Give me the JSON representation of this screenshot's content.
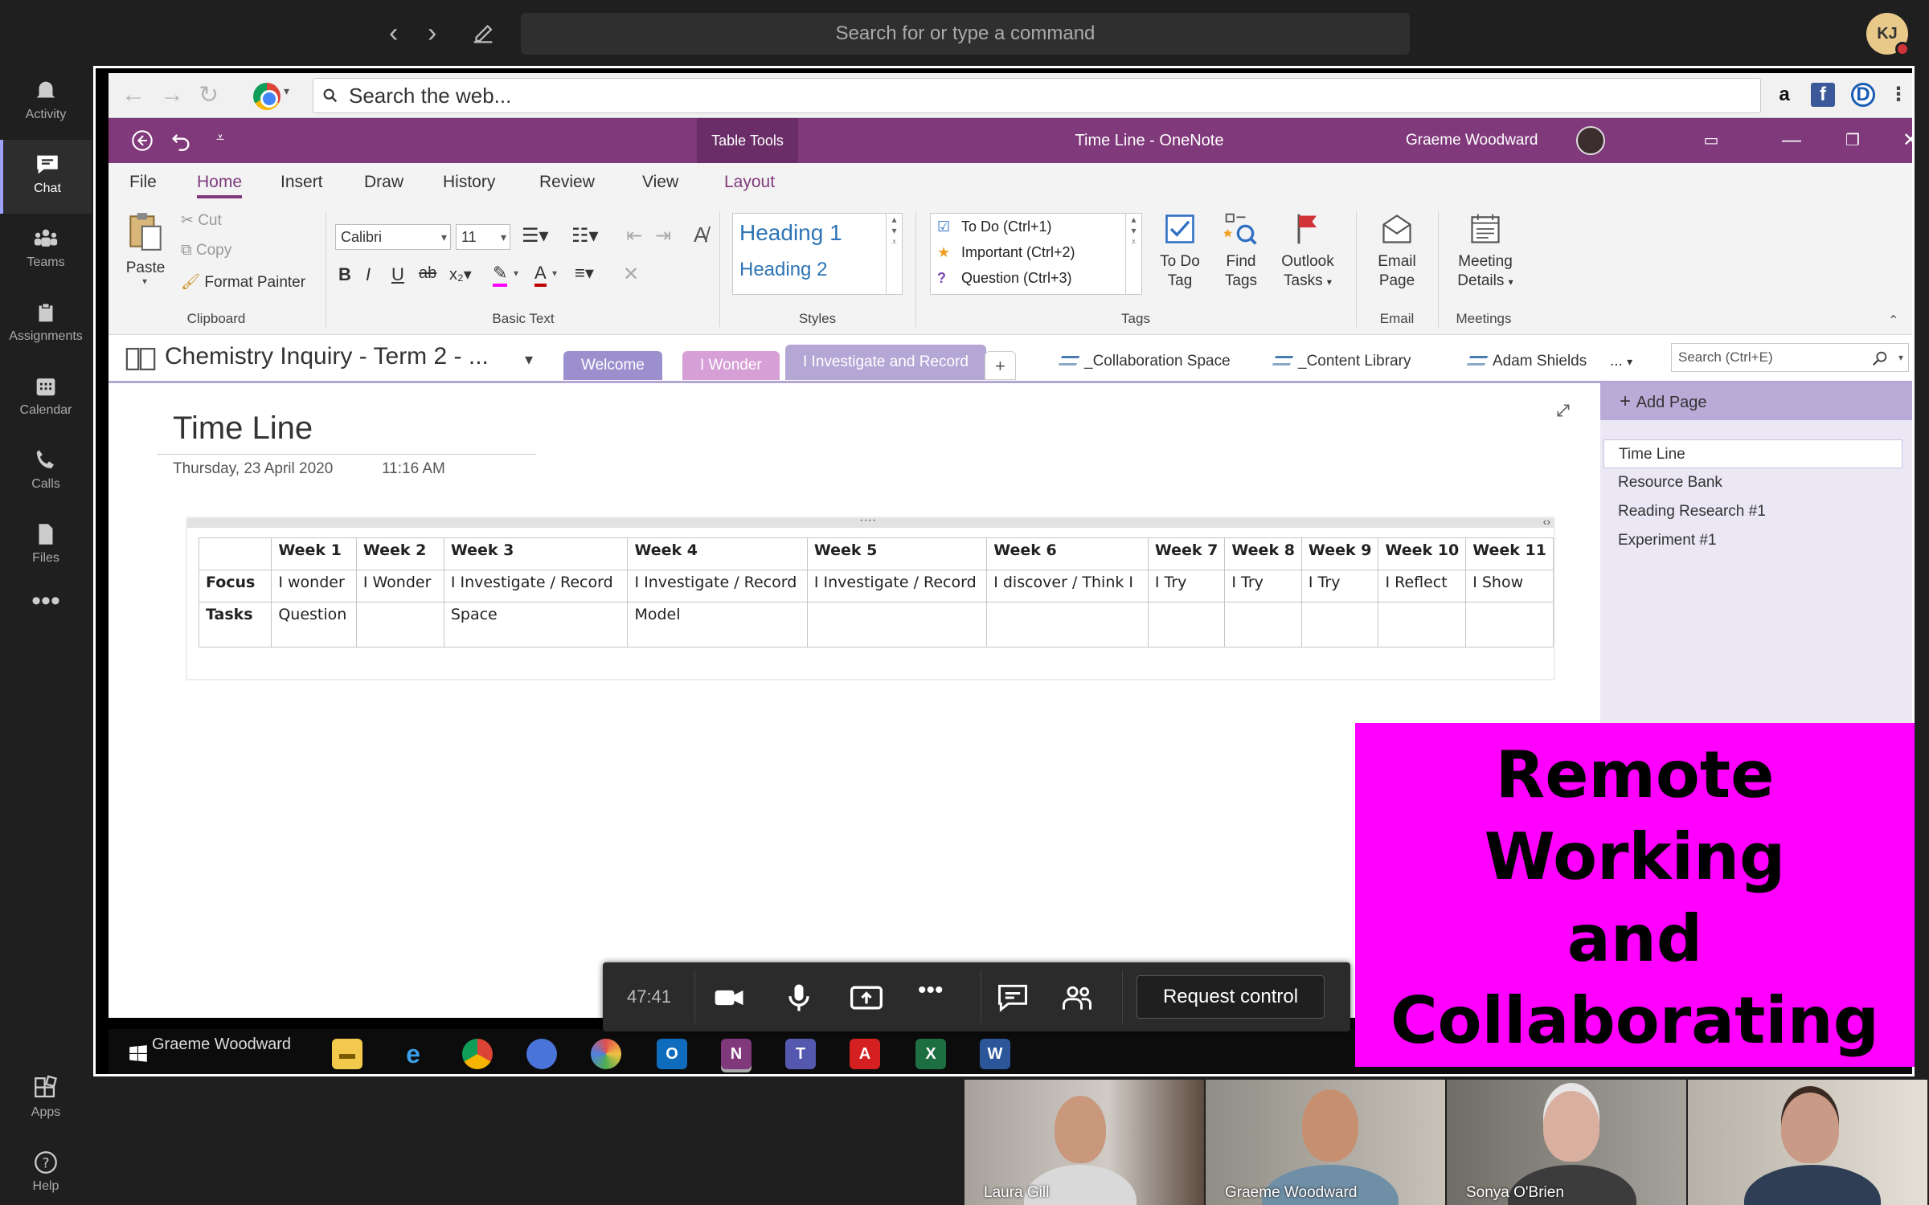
{
  "teams": {
    "search_placeholder": "Search for or type a command",
    "avatar_initials": "KJ",
    "rail": [
      {
        "label": "Activity",
        "icon": "bell-icon"
      },
      {
        "label": "Chat",
        "icon": "chat-icon"
      },
      {
        "label": "Teams",
        "icon": "teams-icon"
      },
      {
        "label": "Assignments",
        "icon": "assignments-icon"
      },
      {
        "label": "Calendar",
        "icon": "calendar-icon"
      },
      {
        "label": "Calls",
        "icon": "phone-icon"
      },
      {
        "label": "Files",
        "icon": "files-icon"
      },
      {
        "label": "Apps",
        "icon": "apps-icon"
      },
      {
        "label": "Help",
        "icon": "help-icon"
      }
    ]
  },
  "browser": {
    "search_placeholder": "Search the web..."
  },
  "onenote": {
    "table_tools": "Table Tools",
    "doc_title": "Time Line  -  OneNote",
    "user_name": "Graeme Woodward",
    "tabs": [
      "File",
      "Home",
      "Insert",
      "Draw",
      "History",
      "Review",
      "View",
      "Layout"
    ],
    "clipboard": {
      "paste": "Paste",
      "cut": "Cut",
      "copy": "Copy",
      "format_painter": "Format Painter",
      "label": "Clipboard"
    },
    "basic_text": {
      "font": "Calibri",
      "size": "11",
      "label": "Basic Text"
    },
    "styles": {
      "h1": "Heading 1",
      "h2": "Heading 2",
      "label": "Styles"
    },
    "tags": {
      "todo": "To Do (Ctrl+1)",
      "important": "Important (Ctrl+2)",
      "question": "Question (Ctrl+3)",
      "label": "Tags"
    },
    "todo_tag": {
      "l1": "To Do",
      "l2": "Tag"
    },
    "find_tags": {
      "l1": "Find",
      "l2": "Tags"
    },
    "outlook_tasks": {
      "l1": "Outlook",
      "l2": "Tasks"
    },
    "email_page": {
      "l1": "Email",
      "l2": "Page",
      "label": "Email"
    },
    "meeting_details": {
      "l1": "Meeting",
      "l2": "Details",
      "label": "Meetings"
    },
    "notebook": "Chemistry Inquiry - Term 2 - ...",
    "sections": [
      "Welcome",
      "I Wonder",
      "I Investigate and Record"
    ],
    "linked": [
      "_Collaboration Space",
      "_Content Library",
      "Adam Shields"
    ],
    "more": "...",
    "page_search": "Search (Ctrl+E)",
    "add_page": "Add Page",
    "pages": [
      "Time Line",
      "Resource Bank",
      "Reading Research #1",
      "Experiment #1"
    ]
  },
  "page": {
    "title": "Time Line",
    "date": "Thursday, 23 April 2020",
    "time": "11:16 AM"
  },
  "table": {
    "header": [
      "",
      "Week 1",
      "Week 2",
      "Week 3",
      "Week 4",
      "Week 5",
      "Week 6",
      "Week 7",
      "Week 8",
      "Week 9",
      "Week 10",
      "Week 11"
    ],
    "focus": [
      "Focus",
      "I wonder",
      "I Wonder",
      "I Investigate / Record",
      "I Investigate / Record",
      "I Investigate / Record",
      "I discover / Think I",
      "I Try",
      "I Try",
      "I Try",
      "I Reflect",
      "I Show"
    ],
    "tasks": [
      "Tasks",
      "Question",
      "",
      "Space",
      "Model",
      "",
      "",
      "",
      "",
      "",
      "",
      ""
    ]
  },
  "meeting": {
    "timer": "47:41",
    "request_control": "Request control"
  },
  "taskbar": {
    "presenter": "Graeme Woodward"
  },
  "banner": {
    "lines": [
      "Remote",
      "Working",
      "and",
      "Collaborating"
    ]
  },
  "participants": [
    "Laura Gill",
    "Graeme Woodward",
    "Sonya O'Brien",
    ""
  ],
  "colors": {
    "onenote_purple": "#80397b",
    "banner_magenta": "#ff00ff",
    "teams_dark": "#1f1f1f"
  }
}
